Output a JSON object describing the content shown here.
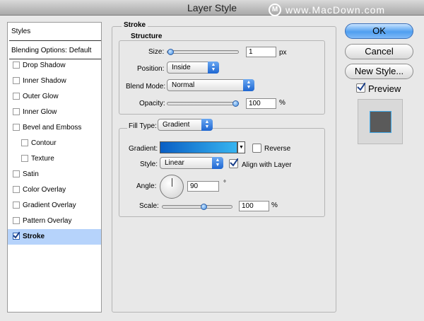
{
  "window": {
    "title": "Layer Style"
  },
  "watermark": {
    "logo": "M",
    "text": "www.MacDown.com"
  },
  "sidebar": {
    "header": "Styles",
    "blending": "Blending Options: Default",
    "items": [
      {
        "label": "Drop Shadow",
        "checked": false
      },
      {
        "label": "Inner Shadow",
        "checked": false
      },
      {
        "label": "Outer Glow",
        "checked": false
      },
      {
        "label": "Inner Glow",
        "checked": false
      },
      {
        "label": "Bevel and Emboss",
        "checked": false
      },
      {
        "label": "Contour",
        "checked": false
      },
      {
        "label": "Texture",
        "checked": false
      },
      {
        "label": "Satin",
        "checked": false
      },
      {
        "label": "Color Overlay",
        "checked": false
      },
      {
        "label": "Gradient Overlay",
        "checked": false
      },
      {
        "label": "Pattern Overlay",
        "checked": false
      },
      {
        "label": "Stroke",
        "checked": true
      }
    ]
  },
  "stroke": {
    "heading": "Stroke",
    "structure": {
      "heading": "Structure",
      "size_label": "Size:",
      "size_value": "1",
      "size_unit": "px",
      "size_fraction": 0.01,
      "position_label": "Position:",
      "position_value": "Inside",
      "blend_label": "Blend Mode:",
      "blend_value": "Normal",
      "opacity_label": "Opacity:",
      "opacity_value": "100",
      "opacity_unit": "%",
      "opacity_fraction": 1.0
    },
    "fill": {
      "type_label": "Fill Type:",
      "type_value": "Gradient",
      "gradient_label": "Gradient:",
      "gradient_colors": [
        "#0a5fc4",
        "#37b4f0"
      ],
      "reverse_label": "Reverse",
      "reverse_checked": false,
      "style_label": "Style:",
      "style_value": "Linear",
      "align_label": "Align with Layer",
      "align_checked": true,
      "angle_label": "Angle:",
      "angle_value": "90",
      "angle_unit": "°",
      "scale_label": "Scale:",
      "scale_value": "100",
      "scale_unit": "%",
      "scale_fraction": 0.6
    }
  },
  "buttons": {
    "ok": "OK",
    "cancel": "Cancel",
    "new_style": "New Style..."
  },
  "preview": {
    "label": "Preview",
    "checked": true,
    "swatch_color": "#5a5a5a",
    "swatch_border": "#3fa7e6"
  }
}
